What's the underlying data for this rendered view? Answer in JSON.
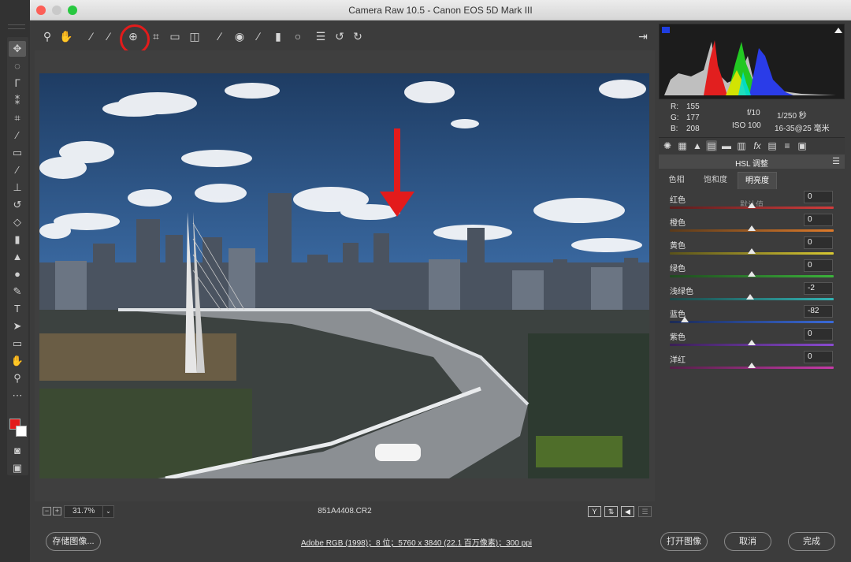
{
  "window": {
    "title": "Camera Raw 10.5  -  Canon EOS 5D Mark III"
  },
  "info": {
    "r_label": "R:",
    "r_value": "155",
    "g_label": "G:",
    "g_value": "177",
    "b_label": "B:",
    "b_value": "208",
    "aperture": "f/10",
    "shutter": "1/250 秒",
    "iso": "ISO 100",
    "lens": "16-35@25 毫米"
  },
  "panel": {
    "title": "HSL 调整",
    "tabs": [
      "色相",
      "饱和度",
      "明亮度"
    ],
    "active_tab": "明亮度",
    "default_link": "默认值",
    "sliders": [
      {
        "label": "红色",
        "value": "0",
        "level": 0,
        "colors": [
          "#5a1d1d",
          "#d23c3c"
        ]
      },
      {
        "label": "橙色",
        "value": "0",
        "level": 0,
        "colors": [
          "#5a3a1a",
          "#e07b2a"
        ]
      },
      {
        "label": "黄色",
        "value": "0",
        "level": 0,
        "colors": [
          "#5a521a",
          "#d8c832"
        ]
      },
      {
        "label": "绿色",
        "value": "0",
        "level": 0,
        "colors": [
          "#1f4a1f",
          "#3bb33b"
        ]
      },
      {
        "label": "浅绿色",
        "value": "-2",
        "level": -2,
        "colors": [
          "#1b4848",
          "#33b3b3"
        ]
      },
      {
        "label": "蓝色",
        "value": "-82",
        "level": -82,
        "colors": [
          "#1b2a55",
          "#3a6ad8"
        ]
      },
      {
        "label": "紫色",
        "value": "0",
        "level": 0,
        "colors": [
          "#3a1f55",
          "#8a4ad0"
        ]
      },
      {
        "label": "洋红",
        "value": "0",
        "level": 0,
        "colors": [
          "#551f48",
          "#c63aa8"
        ]
      }
    ]
  },
  "previewbar": {
    "zoom": "31.7%",
    "filename": "851A4408.CR2",
    "view_y": "Y"
  },
  "footer": {
    "save": "存储图像...",
    "workflow": "Adobe RGB (1998)；8 位；5760 x 3840 (22.1 百万像素)；300 ppi",
    "open": "打开图像",
    "cancel": "取消",
    "done": "完成"
  },
  "colors": {
    "accent_red": "#e31b1b",
    "panel_bg": "#3c3c3c"
  }
}
